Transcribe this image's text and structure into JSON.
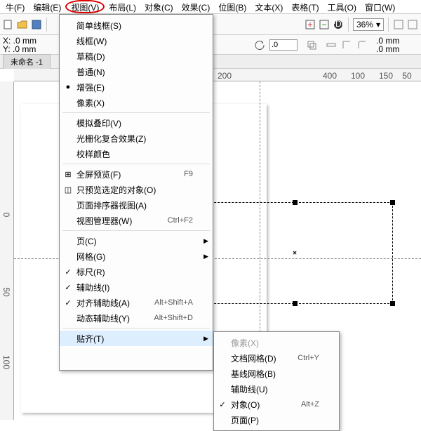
{
  "menubar": {
    "items": [
      "牛(F)",
      "编辑(E)",
      "视图(V)",
      "布局(L)",
      "对象(C)",
      "效果(C)",
      "位图(B)",
      "文本(X)",
      "表格(T)",
      "工具(O)",
      "窗口(W)"
    ],
    "highlight_index": 2
  },
  "toolbar": {
    "zoom": "36%"
  },
  "propbar": {
    "x_label": "X: .0 mm",
    "y_label": "Y: .0 mm",
    "step_value": ".0",
    "unit1": ".0 mm",
    "unit2": ".0 mm"
  },
  "tab": {
    "name": "未命名 -1"
  },
  "ruler_h": [
    "200",
    "400",
    "150",
    "100",
    "50"
  ],
  "ruler_v": [
    "0",
    "50",
    "100"
  ],
  "menu_view": {
    "items": [
      {
        "label": "简单线框(S)"
      },
      {
        "label": "线框(W)"
      },
      {
        "label": "草稿(D)"
      },
      {
        "label": "普通(N)"
      },
      {
        "label": "增强(E)",
        "checked": true,
        "bullet": true
      },
      {
        "label": "像素(X)"
      }
    ],
    "items2": [
      {
        "label": "模拟叠印(V)"
      },
      {
        "label": "光栅化复合效果(Z)"
      },
      {
        "label": "校样颜色"
      }
    ],
    "items3": [
      {
        "icon": "⊞",
        "label": "全屏预览(F)",
        "shortcut": "F9"
      },
      {
        "icon": "◫",
        "label": "只预览选定的对象(O)"
      },
      {
        "label": "页面排序器视图(A)"
      },
      {
        "label": "视图管理器(W)",
        "shortcut": "Ctrl+F2"
      }
    ],
    "items4": [
      {
        "label": "页(C)",
        "submenu": true
      },
      {
        "label": "网格(G)",
        "submenu": true
      },
      {
        "label": "标尺(R)",
        "checked": true
      },
      {
        "label": "辅助线(I)",
        "checked": true,
        "annot": true
      },
      {
        "label": "对齐辅助线(A)",
        "checked": true,
        "shortcut": "Alt+Shift+A",
        "annot": true
      },
      {
        "label": "动态辅助线(Y)",
        "shortcut": "Alt+Shift+D"
      }
    ],
    "items5": [
      {
        "label": "贴齐(T)",
        "submenu": true,
        "hover": true
      }
    ]
  },
  "submenu": {
    "items": [
      {
        "label": "像素(X)",
        "disabled": true
      },
      {
        "label": "文档网格(D)",
        "shortcut": "Ctrl+Y"
      },
      {
        "label": "基线网格(B)"
      },
      {
        "label": "辅助线(U)"
      },
      {
        "label": "对象(O)",
        "checked": true,
        "shortcut": "Alt+Z",
        "annot": true
      },
      {
        "label": "页面(P)"
      }
    ]
  }
}
